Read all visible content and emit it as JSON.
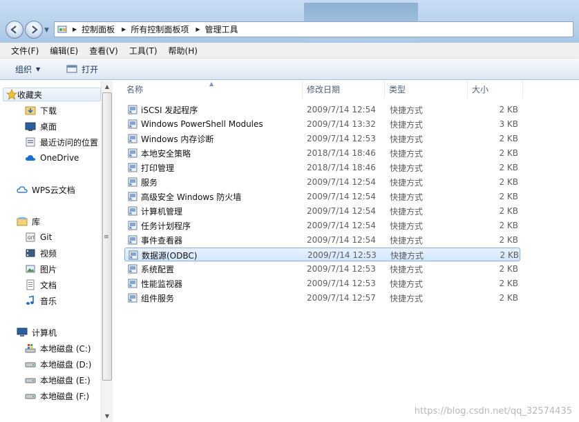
{
  "address": {
    "breadcrumbs": [
      "控制面板",
      "所有控制面板项",
      "管理工具"
    ],
    "separator": "▶"
  },
  "menu": [
    "文件(F)",
    "编辑(E)",
    "查看(V)",
    "工具(T)",
    "帮助(H)"
  ],
  "toolbar": {
    "organize_label": "组织",
    "open_label": "打开"
  },
  "nav": {
    "favorites_label": "收藏夹",
    "favorites": [
      "下载",
      "桌面",
      "最近访问的位置",
      "OneDrive"
    ],
    "wps_label": "WPS云文档",
    "libraries_label": "库",
    "libraries": [
      "Git",
      "视频",
      "图片",
      "文档",
      "音乐"
    ],
    "computer_label": "计算机",
    "drives": [
      "本地磁盘 (C:)",
      "本地磁盘 (D:)",
      "本地磁盘 (E:)",
      "本地磁盘 (F:)"
    ]
  },
  "columns": {
    "name": "名称",
    "date": "修改日期",
    "type": "类型",
    "size": "大小"
  },
  "files": [
    {
      "name": "iSCSI 发起程序",
      "date": "2009/7/14 12:54",
      "type": "快捷方式",
      "size": "2 KB"
    },
    {
      "name": "Windows PowerShell Modules",
      "date": "2009/7/14 13:32",
      "type": "快捷方式",
      "size": "3 KB"
    },
    {
      "name": "Windows 内存诊断",
      "date": "2009/7/14 12:53",
      "type": "快捷方式",
      "size": "2 KB"
    },
    {
      "name": "本地安全策略",
      "date": "2018/7/14 18:46",
      "type": "快捷方式",
      "size": "2 KB"
    },
    {
      "name": "打印管理",
      "date": "2018/7/14 18:46",
      "type": "快捷方式",
      "size": "2 KB"
    },
    {
      "name": "服务",
      "date": "2009/7/14 12:54",
      "type": "快捷方式",
      "size": "2 KB"
    },
    {
      "name": "高级安全 Windows 防火墙",
      "date": "2009/7/14 12:54",
      "type": "快捷方式",
      "size": "2 KB"
    },
    {
      "name": "计算机管理",
      "date": "2009/7/14 12:54",
      "type": "快捷方式",
      "size": "2 KB"
    },
    {
      "name": "任务计划程序",
      "date": "2009/7/14 12:54",
      "type": "快捷方式",
      "size": "2 KB"
    },
    {
      "name": "事件查看器",
      "date": "2009/7/14 12:54",
      "type": "快捷方式",
      "size": "2 KB"
    },
    {
      "name": "数据源(ODBC)",
      "date": "2009/7/14 12:53",
      "type": "快捷方式",
      "size": "2 KB"
    },
    {
      "name": "系统配置",
      "date": "2009/7/14 12:53",
      "type": "快捷方式",
      "size": "2 KB"
    },
    {
      "name": "性能监视器",
      "date": "2009/7/14 12:53",
      "type": "快捷方式",
      "size": "2 KB"
    },
    {
      "name": "组件服务",
      "date": "2009/7/14 12:57",
      "type": "快捷方式",
      "size": "2 KB"
    }
  ],
  "selected_file": "数据源(ODBC)",
  "watermark": "https://blog.csdn.net/qq_32574435",
  "colors": {
    "selection_border": "#84acdd",
    "address_border": "#8ea4c1",
    "title_gradient_top": "#c7dcf2"
  }
}
